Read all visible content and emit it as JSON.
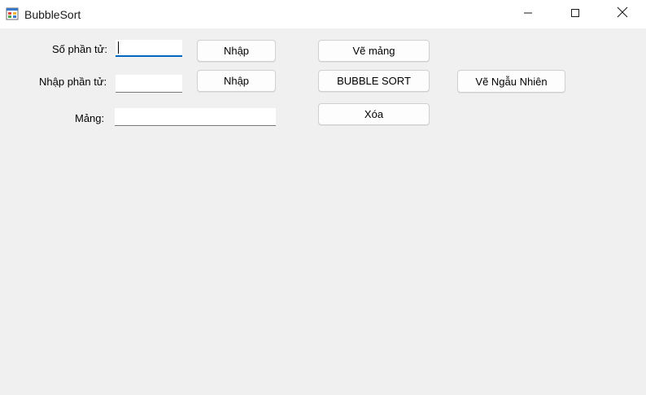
{
  "window": {
    "title": "BubbleSort",
    "icon": "app-form-icon",
    "controls": {
      "minimize": "minimize-icon",
      "maximize": "maximize-icon",
      "close": "close-icon"
    }
  },
  "form": {
    "so_phan_tu_label": "Số phần tử:",
    "so_phan_tu_value": "",
    "nhap_phan_tu_label": "Nhập phần tử:",
    "nhap_phan_tu_value": "",
    "mang_label": "Mảng:",
    "mang_value": ""
  },
  "buttons": {
    "nhap_1": "Nhập",
    "nhap_2": "Nhập",
    "ve_mang": "Vẽ mảng",
    "bubble_sort": "BUBBLE SORT",
    "ve_ngau_nhien": "Vẽ Ngẫu Nhiên",
    "xoa": "Xóa"
  },
  "colors": {
    "background": "#f0f0f0",
    "titlebar": "#ffffff",
    "focus_accent": "#0067c0"
  }
}
